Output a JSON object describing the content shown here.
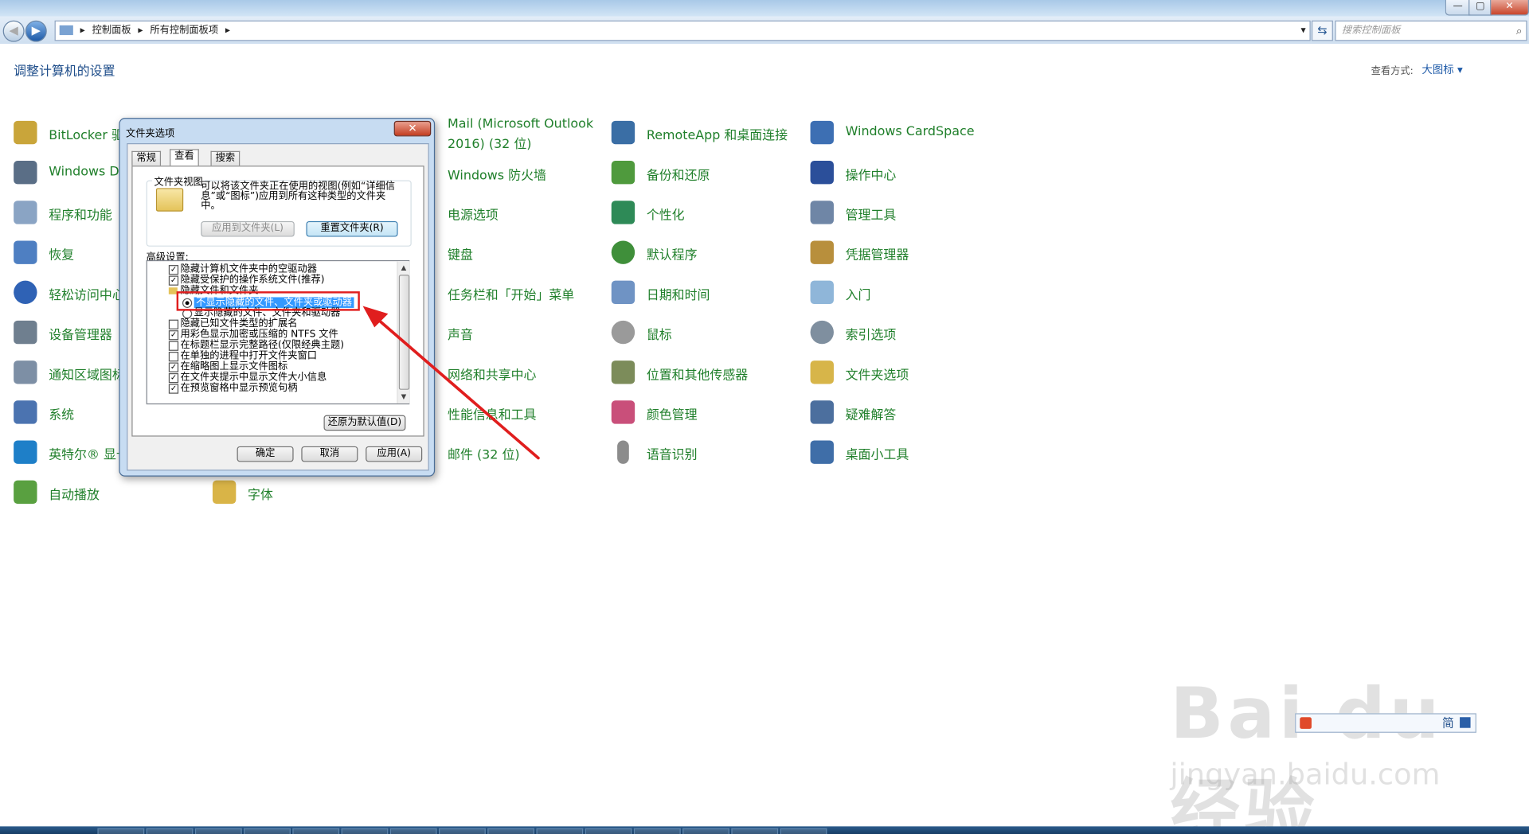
{
  "window": {
    "min_glyph": "—",
    "max_glyph": "▢",
    "close_glyph": "✕"
  },
  "address": {
    "crumb1": "控制面板",
    "crumb2": "所有控制面板项",
    "search_placeholder": "搜索控制面板",
    "back_glyph": "◀",
    "forward_glyph": "▶",
    "refresh_glyph": "⇆"
  },
  "header": {
    "title": "调整计算机的设置",
    "view_by_label": "查看方式:",
    "view_by_value": "大图标 ▾"
  },
  "items": [
    {
      "label": "BitLocker 驱",
      "color": "#c9a53a"
    },
    {
      "label": "Windows D",
      "color": "#5a6e86"
    },
    {
      "label": "程序和功能",
      "color": "#8aa4c4"
    },
    {
      "label": "恢复",
      "color": "#4e7fc2"
    },
    {
      "label": "轻松访问中心",
      "color": "#2f62b5"
    },
    {
      "label": "设备管理器",
      "color": "#6f7f8f"
    },
    {
      "label": "通知区域图标",
      "color": "#7d8fa5"
    },
    {
      "label": "系统",
      "color": "#4b73b0"
    },
    {
      "label": "英特尔® 显卡",
      "color": "#1e7fc8"
    },
    {
      "label": "自动播放",
      "color": "#59a040"
    },
    {
      "label": "字体",
      "color": "#d9b447"
    },
    {
      "label": "Mail (Microsoft Outlook",
      "color": "#ffffff"
    },
    {
      "label": "2016) (32 位)",
      "color": "#ffffff"
    },
    {
      "label": "Windows 防火墙",
      "color": "#ffffff"
    },
    {
      "label": "电源选项",
      "color": "#ffffff"
    },
    {
      "label": "键盘",
      "color": "#ffffff"
    },
    {
      "label": "任务栏和「开始」菜单",
      "color": "#ffffff"
    },
    {
      "label": "声音",
      "color": "#ffffff"
    },
    {
      "label": "网络和共享中心",
      "color": "#ffffff"
    },
    {
      "label": "性能信息和工具",
      "color": "#ffffff"
    },
    {
      "label": "邮件 (32 位)",
      "color": "#ffffff"
    },
    {
      "label": "RemoteApp 和桌面连接",
      "color": "#3a6ea5"
    },
    {
      "label": "备份和还原",
      "color": "#4f9a3d"
    },
    {
      "label": "个性化",
      "color": "#2e8a57"
    },
    {
      "label": "默认程序",
      "color": "#3f8f3a"
    },
    {
      "label": "日期和时间",
      "color": "#6f93c4"
    },
    {
      "label": "鼠标",
      "color": "#9a9a9a"
    },
    {
      "label": "位置和其他传感器",
      "color": "#7c8c5a"
    },
    {
      "label": "颜色管理",
      "color": "#c94f7a"
    },
    {
      "label": "语音识别",
      "color": "#8c8c8c"
    },
    {
      "label": "Windows CardSpace",
      "color": "#3d6fb3"
    },
    {
      "label": "操作中心",
      "color": "#2b4f9a"
    },
    {
      "label": "管理工具",
      "color": "#6f86a6"
    },
    {
      "label": "凭据管理器",
      "color": "#b88f3c"
    },
    {
      "label": "入门",
      "color": "#8fb6d9"
    },
    {
      "label": "索引选项",
      "color": "#7f8f9f"
    },
    {
      "label": "文件夹选项",
      "color": "#d7b549"
    },
    {
      "label": "疑难解答",
      "color": "#4c6f9e"
    },
    {
      "label": "桌面小工具",
      "color": "#3f6ea8"
    }
  ],
  "dialog": {
    "title": "文件夹选项",
    "close_glyph": "✕",
    "tabs": [
      "常规",
      "查看",
      "搜索"
    ],
    "folder_view_title": "文件夹视图",
    "folder_view_desc": "可以将该文件夹正在使用的视图(例如“详细信息”或“图标”)应用到所有这种类型的文件夹中。",
    "apply_to_folders": "应用到文件夹(L)",
    "reset_folders": "重置文件夹(R)",
    "advanced_label": "高级设置:",
    "advanced_rows": [
      {
        "text": "隐藏计算机文件夹中的空驱动器",
        "state": "✓"
      },
      {
        "text": "隐藏受保护的操作系统文件(推荐)",
        "state": "✓"
      },
      {
        "text": "隐藏文件和文件夹",
        "state": "folder"
      },
      {
        "text": "不显示隐藏的文件、文件夹或驱动器",
        "state": "radio-on"
      },
      {
        "text": "显示隐藏的文件、文件夹和驱动器",
        "state": "radio-off"
      },
      {
        "text": "隐藏已知文件类型的扩展名",
        "state": ""
      },
      {
        "text": "用彩色显示加密或压缩的 NTFS 文件",
        "state": "✓"
      },
      {
        "text": "在标题栏显示完整路径(仅限经典主题)",
        "state": ""
      },
      {
        "text": "在单独的进程中打开文件夹窗口",
        "state": ""
      },
      {
        "text": "在缩略图上显示文件图标",
        "state": "✓"
      },
      {
        "text": "在文件夹提示中显示文件大小信息",
        "state": "✓"
      },
      {
        "text": "在预览窗格中显示预览句柄",
        "state": "✓"
      }
    ],
    "restore_defaults": "还原为默认值(D)",
    "ok": "确定",
    "cancel": "取消",
    "apply": "应用(A)",
    "scroll_up": "▲",
    "scroll_down": "▼"
  },
  "watermark": {
    "logo": "Bai du 经验",
    "url": "jingyan.baidu.com"
  },
  "ime_bar": {
    "text": "简"
  },
  "annotation_color": "#e01e1e"
}
